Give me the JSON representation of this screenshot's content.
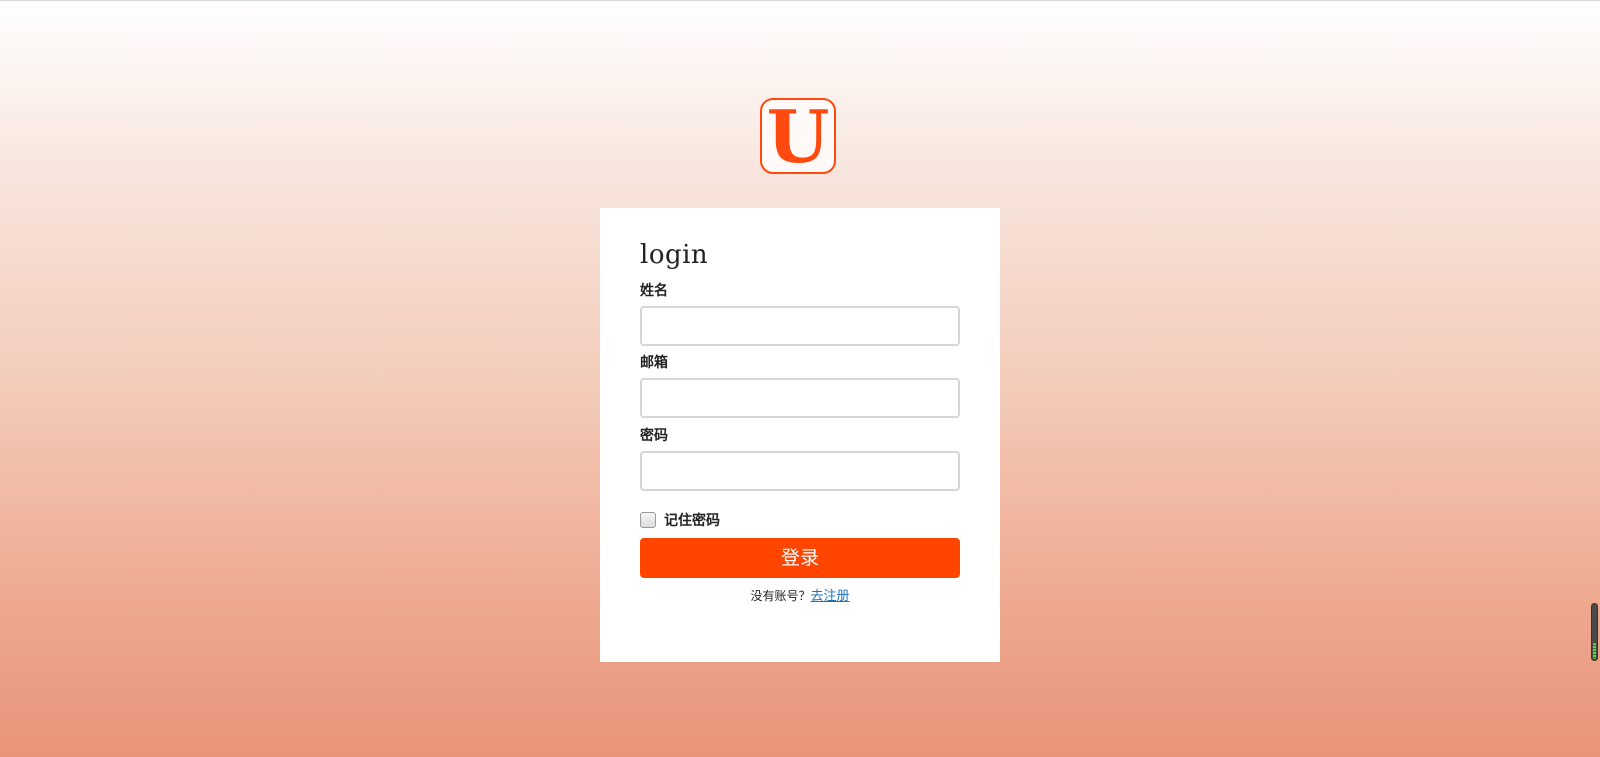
{
  "logo": {
    "letter": "U",
    "color": "#ff4a0f"
  },
  "form": {
    "title": "login",
    "name_label": "姓名",
    "name_value": "",
    "email_label": "邮箱",
    "email_value": "",
    "password_label": "密码",
    "password_value": "",
    "remember_label": "记住密码",
    "remember_checked": false,
    "submit_label": "登录",
    "no_account_text": "没有账号？",
    "register_link": "去注册"
  },
  "colors": {
    "accent": "#ff4500",
    "link": "#1a73b8",
    "background_top": "#ffffff",
    "background_bottom": "#e8947a"
  },
  "scroll_indicator": {
    "level": 0.3
  }
}
